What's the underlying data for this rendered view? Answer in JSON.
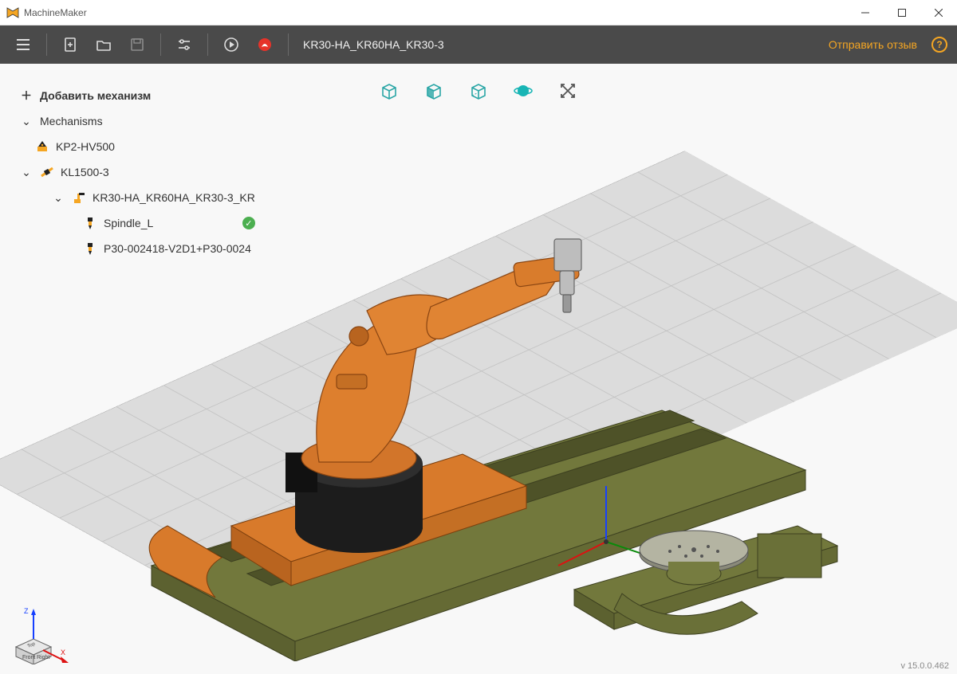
{
  "window": {
    "title": "MachineMaker"
  },
  "toolbar": {
    "doc_title": "KR30-HA_KR60HA_KR30-3",
    "feedback": "Отправить отзыв"
  },
  "tree": {
    "add_label": "Добавить механизм",
    "root_label": "Mechanisms",
    "items": {
      "kp2": "KP2-HV500",
      "kl1500": "KL1500-3",
      "kr30": "KR30-HA_KR60HA_KR30-3_KR",
      "spindle": "Spindle_L",
      "p30": "P30-002418-V2D1+P30-0024"
    }
  },
  "footer": {
    "version": "v 15.0.0.462"
  },
  "axis_labels": {
    "x": "X",
    "z": "Z",
    "front": "Front",
    "right": "Right",
    "top": "Top"
  }
}
